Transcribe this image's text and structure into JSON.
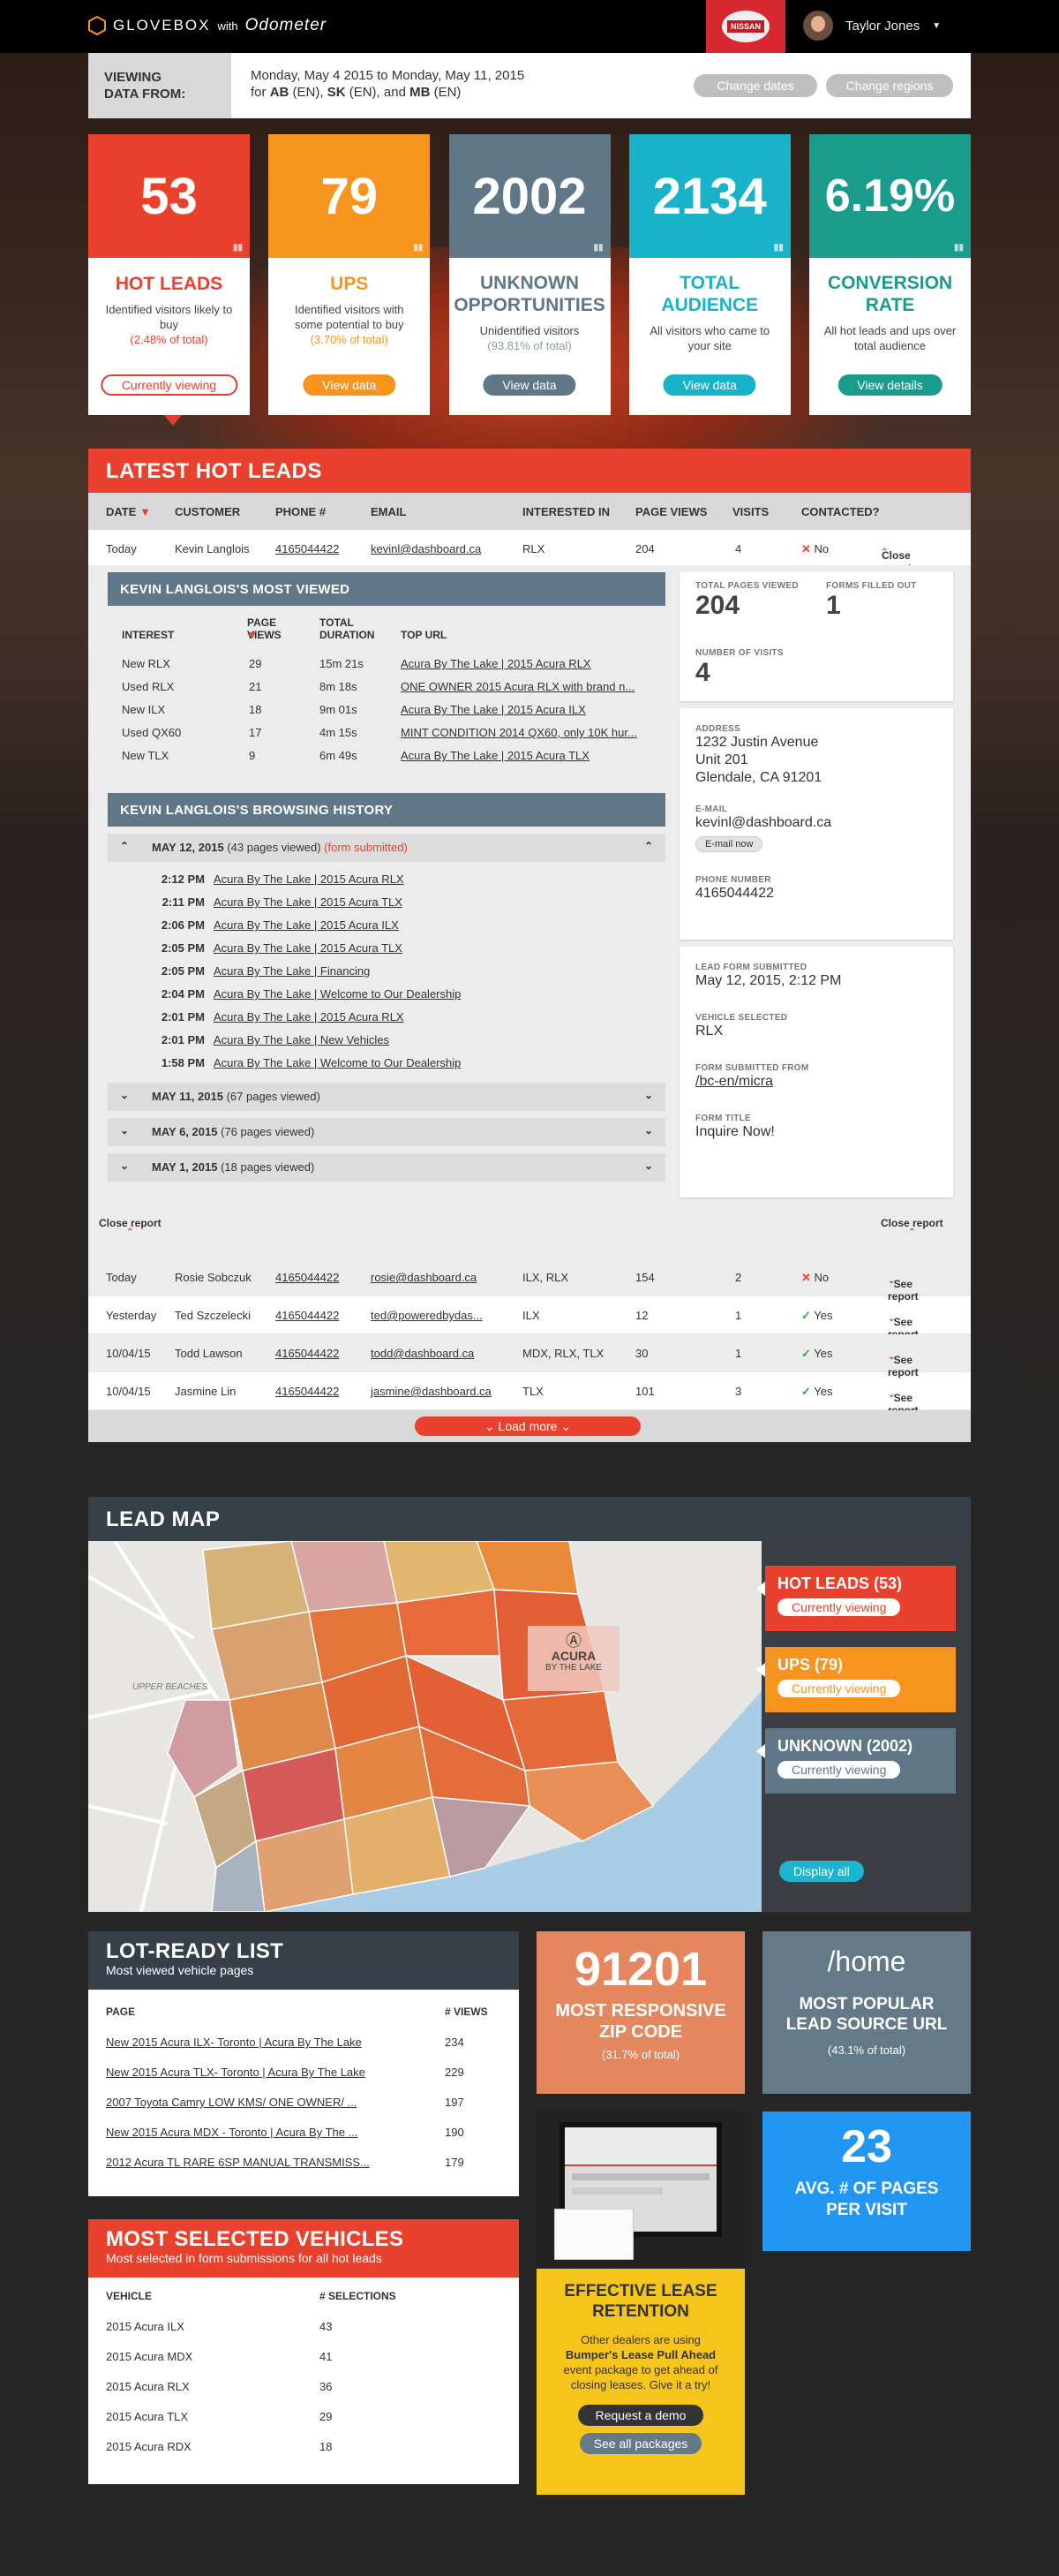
{
  "topbar": {
    "brand": "GLOVEBOX",
    "with": "with",
    "product": "Odometer",
    "dealer_badge": "NISSAN",
    "user_name": "Taylor Jones"
  },
  "viewing": {
    "label_line1": "VIEWING",
    "label_line2": "DATA FROM:",
    "dates": "Monday, May 4 2015 to Monday, May 11, 2015",
    "regions_prefix": "for",
    "regions": [
      {
        "code": "AB",
        "lang": "(EN),"
      },
      {
        "code": "SK",
        "lang": "(EN), and"
      },
      {
        "code": "MB",
        "lang": "(EN)"
      }
    ],
    "change_dates": "Change dates",
    "change_regions": "Change regions"
  },
  "stats": [
    {
      "value": "53",
      "title": "HOT LEADS",
      "desc": "Identified visitors likely to buy",
      "pct": "(2.48% of total)",
      "button": "Currently viewing",
      "color": "#e9412e",
      "pct_color": "#e9412e"
    },
    {
      "value": "79",
      "title": "UPS",
      "desc": "Identified visitors with some potential to buy",
      "pct": "(3.70% of total)",
      "button": "View data",
      "color": "#f7941d",
      "pct_color": "#f7941d"
    },
    {
      "value": "2002",
      "title": "UNKNOWN OPPORTUNITIES",
      "desc": "Unidentified visitors",
      "pct": "(93.81% of total)",
      "button": "View data",
      "color": "#5f7787",
      "pct_color": "#8a9ba6"
    },
    {
      "value": "2134",
      "title": "TOTAL AUDIENCE",
      "desc": "All visitors who came to your site",
      "pct": "",
      "button": "View data",
      "color": "#18b3c8",
      "pct_color": "#18b3c8"
    },
    {
      "value": "6.19%",
      "title": "CONVERSION RATE",
      "desc": "All hot leads and ups over total audience",
      "pct": "",
      "button": "View details",
      "color": "#1a9c8c",
      "pct_color": "#1a9c8c"
    }
  ],
  "leads": {
    "title": "LATEST HOT LEADS",
    "columns": [
      "DATE",
      "CUSTOMER",
      "PHONE #",
      "EMAIL",
      "INTERESTED IN",
      "PAGE VIEWS",
      "VISITS",
      "CONTACTED?"
    ],
    "first": {
      "date": "Today",
      "customer": "Kevin Langlois",
      "phone": "4165044422",
      "email": "kevinl@dashboard.ca",
      "interest": "RLX",
      "views": "204",
      "visits": "4",
      "contacted": "No",
      "action": "Close report"
    },
    "most_viewed": {
      "title": "KEVIN LANGLOIS'S MOST VIEWED",
      "columns": [
        "INTEREST",
        "PAGE",
        "VIEWS",
        "TOTAL",
        "DURATION",
        "TOP URL"
      ],
      "rows": [
        {
          "interest": "New RLX",
          "views": "29",
          "duration": "15m 21s",
          "url": "Acura By The Lake | 2015 Acura RLX"
        },
        {
          "interest": "Used RLX",
          "views": "21",
          "duration": "8m 18s",
          "url": "ONE OWNER 2015 Acura RLX with brand n..."
        },
        {
          "interest": "New ILX",
          "views": "18",
          "duration": "9m 01s",
          "url": "Acura By The Lake | 2015 Acura ILX"
        },
        {
          "interest": "Used QX60",
          "views": "17",
          "duration": "4m 15s",
          "url": "MINT CONDITION 2014 QX60, only 10K hur..."
        },
        {
          "interest": "New TLX",
          "views": "9",
          "duration": "6m 49s",
          "url": "Acura By The Lake | 2015 Acura TLX"
        }
      ]
    },
    "browsing": {
      "title": "KEVIN LANGLOIS'S BROWSING HISTORY",
      "open_day": {
        "date": "MAY 12, 2015",
        "count": "(43 pages viewed)",
        "flag": "(form submitted)"
      },
      "visits": [
        {
          "time": "2:12 PM",
          "page": "Acura By The Lake | 2015 Acura RLX"
        },
        {
          "time": "2:11 PM",
          "page": "Acura By The Lake | 2015 Acura TLX"
        },
        {
          "time": "2:06 PM",
          "page": "Acura By The Lake | 2015 Acura ILX"
        },
        {
          "time": "2:05 PM",
          "page": "Acura By The Lake | 2015 Acura TLX"
        },
        {
          "time": "2:05 PM",
          "page": "Acura By The Lake | Financing"
        },
        {
          "time": "2:04 PM",
          "page": "Acura By The Lake | Welcome to Our Dealership"
        },
        {
          "time": "2:01 PM",
          "page": "Acura By The Lake | 2015 Acura RLX"
        },
        {
          "time": "2:01 PM",
          "page": "Acura By The Lake | New Vehicles"
        },
        {
          "time": "1:58 PM",
          "page": "Acura By The Lake | Welcome to Our Dealership"
        }
      ],
      "other_days": [
        {
          "date": "MAY 11, 2015",
          "count": "(67 pages viewed)"
        },
        {
          "date": "MAY 6, 2015",
          "count": "(76 pages viewed)"
        },
        {
          "date": "MAY 1, 2015",
          "count": "(18 pages viewed)"
        }
      ]
    },
    "summary": {
      "total_views_label": "TOTAL PAGES VIEWED",
      "total_views": "204",
      "forms_label": "FORMS FILLED OUT",
      "forms": "1",
      "visits_label": "NUMBER OF VISITS",
      "visits": "4"
    },
    "contact": {
      "address_label": "ADDRESS",
      "address1": "1232 Justin Avenue",
      "address2": "Unit 201",
      "address3": "Glendale, CA 91201",
      "email_label": "E-MAIL",
      "email": "kevinl@dashboard.ca",
      "email_btn": "E-mail now",
      "phone_label": "PHONE NUMBER",
      "phone": "4165044422"
    },
    "form": {
      "submitted_label": "LEAD FORM SUBMITTED",
      "submitted": "May 12, 2015, 2:12 PM",
      "vehicle_label": "VEHICLE SELECTED",
      "vehicle": "RLX",
      "from_label": "FORM SUBMITTED FROM",
      "from": "/bc-en/micra",
      "title_label": "FORM TITLE",
      "title": "Inquire Now!"
    },
    "close_left": "Close report",
    "close_right": "Close report",
    "rows": [
      {
        "date": "Today",
        "customer": "Rosie Sobczuk",
        "phone": "4165044422",
        "email": "rosie@dashboard.ca",
        "interest": "ILX, RLX",
        "views": "154",
        "visits": "2",
        "contacted": "No",
        "action": "See report"
      },
      {
        "date": "Yesterday",
        "customer": "Ted Szczelecki",
        "phone": "4165044422",
        "email": "ted@poweredbydas...",
        "interest": "ILX",
        "views": "12",
        "visits": "1",
        "contacted": "Yes",
        "action": "See report"
      },
      {
        "date": "10/04/15",
        "customer": "Todd Lawson",
        "phone": "4165044422",
        "email": "todd@dashboard.ca",
        "interest": "MDX, RLX, TLX",
        "views": "30",
        "visits": "1",
        "contacted": "Yes",
        "action": "See report"
      },
      {
        "date": "10/04/15",
        "customer": "Jasmine Lin",
        "phone": "4165044422",
        "email": "jasmine@dashboard.ca",
        "interest": "TLX",
        "views": "101",
        "visits": "3",
        "contacted": "Yes",
        "action": "See report"
      }
    ],
    "load_more": "Load more"
  },
  "leadmap": {
    "title": "LEAD MAP",
    "area_label": "UPPER BEACHES",
    "dealer_name": "ACURA",
    "dealer_sub": "BY THE LAKE",
    "chips": [
      {
        "title": "HOT LEADS (53)",
        "button": "Currently viewing",
        "color": "#e9412e"
      },
      {
        "title": "UPS (79)",
        "button": "Currently viewing",
        "color": "#f7941d"
      },
      {
        "title": "UNKNOWN (2002)",
        "button": "Currently viewing",
        "color": "#5f7787"
      }
    ],
    "display_all": "Display all"
  },
  "lot": {
    "title": "LOT-READY LIST",
    "subtitle": "Most viewed vehicle pages",
    "col_page": "PAGE",
    "col_views": "# VIEWS",
    "rows": [
      {
        "page": "New 2015 Acura ILX- Toronto | Acura By The Lake",
        "views": "234"
      },
      {
        "page": "New 2015 Acura TLX- Toronto | Acura By The Lake",
        "views": "229"
      },
      {
        "page": "2007 Toyota Camry LOW KMS/ ONE OWNER/ ...",
        "views": "197"
      },
      {
        "page": "New 2015 Acura MDX - Toronto | Acura By The ...",
        "views": "190"
      },
      {
        "page": "2012 Acura TL RARE 6SP MANUAL TRANSMISS...",
        "views": "179"
      }
    ]
  },
  "vehicles": {
    "title": "MOST SELECTED VEHICLES",
    "subtitle": "Most selected in form submissions for all hot leads",
    "col_vehicle": "VEHICLE",
    "col_sel": "# SELECTIONS",
    "rows": [
      {
        "vehicle": "2015 Acura ILX",
        "count": "43"
      },
      {
        "vehicle": "2015 Acura MDX",
        "count": "41"
      },
      {
        "vehicle": "2015 Acura RLX",
        "count": "36"
      },
      {
        "vehicle": "2015 Acura TLX",
        "count": "29"
      },
      {
        "vehicle": "2015 Acura RDX",
        "count": "18"
      }
    ]
  },
  "zip": {
    "value": "91201",
    "label": "MOST RESPONSIVE ZIP CODE",
    "pct": "(31.7% of total)"
  },
  "url": {
    "value": "/home",
    "label": "MOST POPULAR LEAD SOURCE URL",
    "pct": "(43.1% of total)"
  },
  "avg": {
    "value": "23",
    "label": "AVG. # OF PAGES PER VISIT"
  },
  "promo": {
    "title": "EFFECTIVE LEASE RETENTION",
    "body_pre": "Other dealers are using",
    "body_bold": "Bumper's Lease Pull Ahead",
    "body_post": "event package to get ahead of closing leases. Give it a try!",
    "btn1": "Request a demo",
    "btn2": "See all packages"
  }
}
